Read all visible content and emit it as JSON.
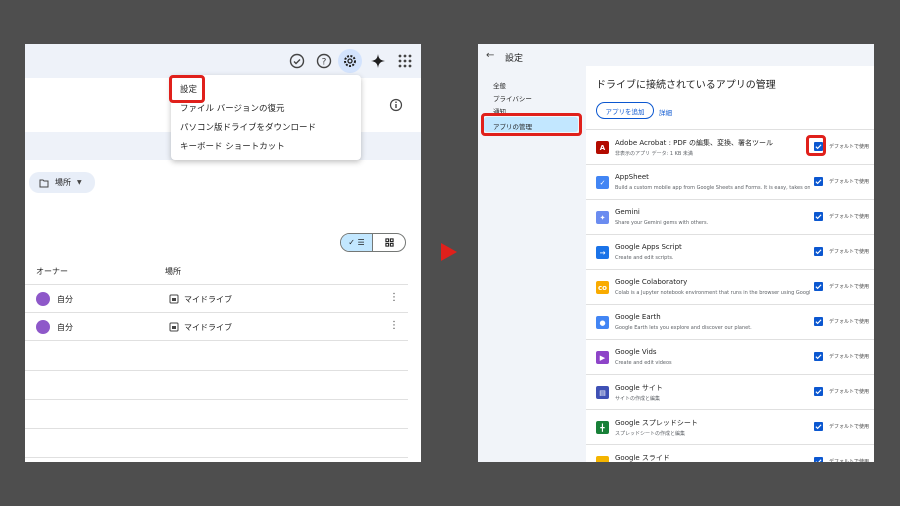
{
  "left_panel": {
    "menu": {
      "items": [
        "設定",
        "ファイル バージョンの復元",
        "パソコン版ドライブをダウンロード",
        "キーボード ショートカット"
      ]
    },
    "filter_chip": "場所",
    "columns": {
      "owner": "オーナー",
      "location": "場所"
    },
    "rows": [
      {
        "owner": "自分",
        "location": "マイドライブ"
      },
      {
        "owner": "自分",
        "location": "マイドライブ"
      }
    ],
    "icons": [
      "check-circle-icon",
      "help-icon",
      "gear-icon",
      "gemini-spark-icon",
      "apps-grid-icon",
      "info-icon",
      "folder-icon",
      "list-view-icon",
      "grid-view-icon",
      "more-vert-icon",
      "drive-icon"
    ]
  },
  "right_panel": {
    "title": "設定",
    "nav": [
      "全般",
      "プライバシー",
      "通知",
      "アプリの管理"
    ],
    "content_title": "ドライブに接続されているアプリの管理",
    "add_app": "アプリを追加",
    "details": "詳細",
    "default_label": "デフォルトで使用",
    "apps": [
      {
        "name": "Adobe Acrobat : PDF の編集、変換、署名ツール",
        "desc": "非表示のアプリ データ: 1 KB 未満",
        "icon_color": "#b30b00",
        "icon_char": "A"
      },
      {
        "name": "AppSheet",
        "desc": "Build a custom mobile app from Google Sheets and Forms. It is easy, takes onl...",
        "icon_color": "#4285f4",
        "icon_char": "✓"
      },
      {
        "name": "Gemini",
        "desc": "Share your Gemini gems with others.",
        "icon_color": "#6b8cf0",
        "icon_char": "✦"
      },
      {
        "name": "Google Apps Script",
        "desc": "Create and edit scripts.",
        "icon_color": "#1a73e8",
        "icon_char": "→"
      },
      {
        "name": "Google Colaboratory",
        "desc": "Colab is a Jupyter notebook environment that runs in the browser using Googl...",
        "icon_color": "#f9ab00",
        "icon_char": "co"
      },
      {
        "name": "Google Earth",
        "desc": "Google Earth lets you explore and discover our planet.",
        "icon_color": "#4285f4",
        "icon_char": "●"
      },
      {
        "name": "Google Vids",
        "desc": "Create and edit videos",
        "icon_color": "#8e44c8",
        "icon_char": "▶"
      },
      {
        "name": "Google サイト",
        "desc": "サイトの作成と編集",
        "icon_color": "#3f51b5",
        "icon_char": "▤"
      },
      {
        "name": "Google スプレッドシート",
        "desc": "スプレッドシートの作成と編集",
        "icon_color": "#188038",
        "icon_char": "╋"
      },
      {
        "name": "Google スライド",
        "desc": "",
        "icon_color": "#f4b400",
        "icon_char": "▭"
      }
    ]
  },
  "colors": {
    "highlight": "#e0201b",
    "accent": "#0b57d0",
    "selected": "#c2e7ff"
  }
}
